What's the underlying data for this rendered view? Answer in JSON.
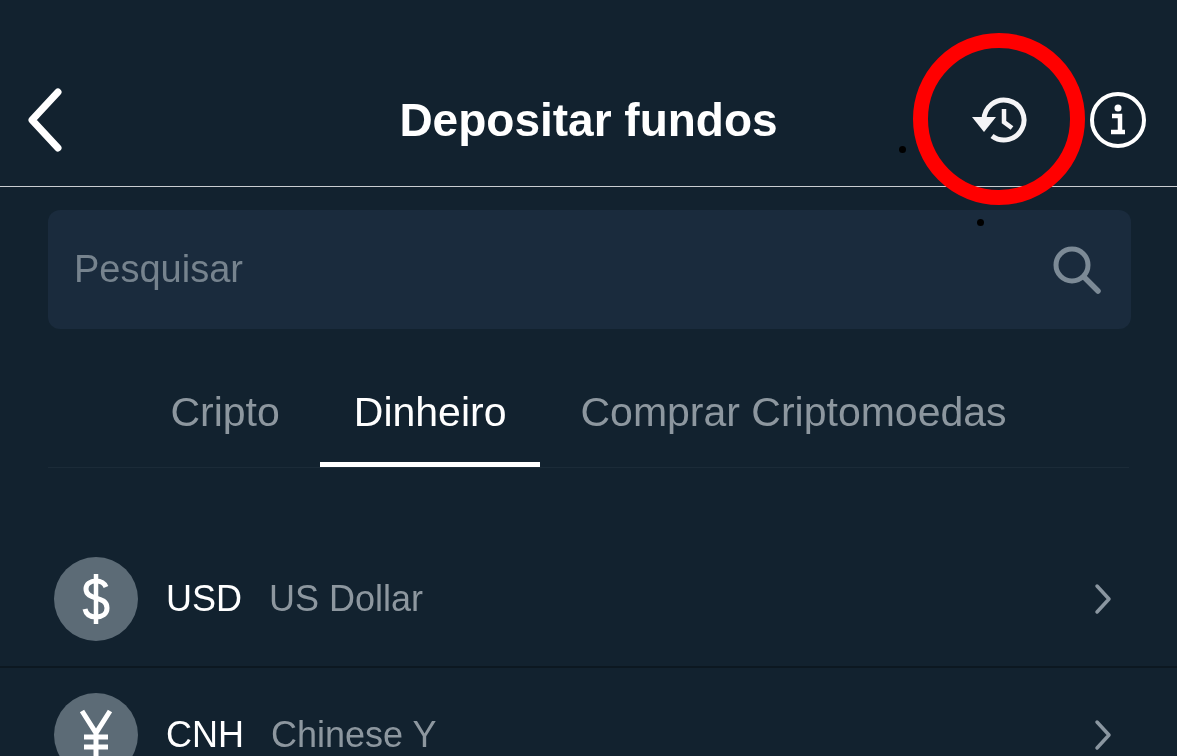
{
  "header": {
    "title": "Depositar fundos"
  },
  "search": {
    "placeholder": "Pesquisar"
  },
  "tabs": [
    {
      "label": "Cripto",
      "selected": false
    },
    {
      "label": "Dinheiro",
      "selected": true
    },
    {
      "label": "Comprar Criptomoedas",
      "selected": false
    }
  ],
  "currencies": [
    {
      "kind": "dollar",
      "code": "USD",
      "name": "US Dollar"
    },
    {
      "kind": "yuan",
      "code": "CNH",
      "name": "Chinese Y"
    }
  ]
}
